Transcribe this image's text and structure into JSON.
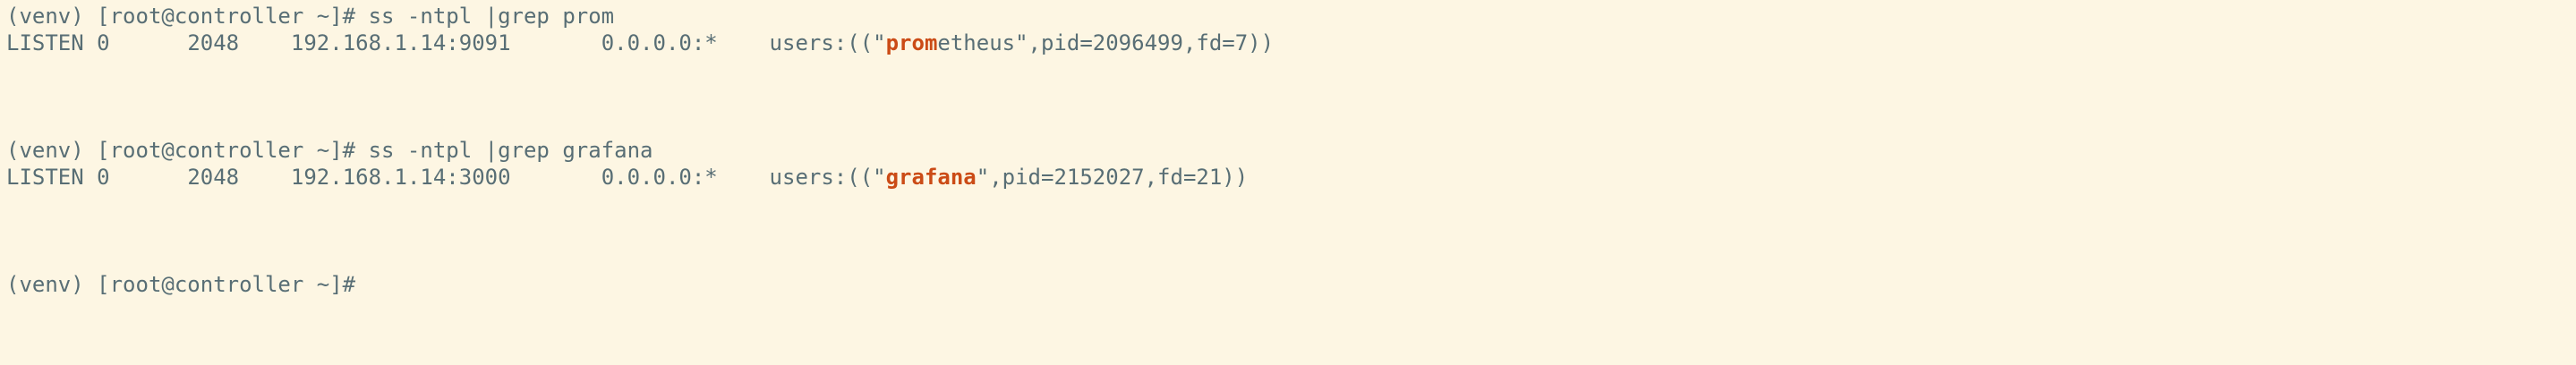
{
  "terminal": {
    "lines": [
      {
        "prompt": "(venv) [root@controller ~]# ",
        "command": "ss -ntpl |grep prom"
      },
      {
        "state": "LISTEN",
        "recvq": "0",
        "sendq": "2048",
        "local": "192.168.1.14:9091",
        "peer": "0.0.0.0:*",
        "users_prefix": "users:((\"",
        "match": "prom",
        "rest": "etheus\",pid=2096499,fd=7))"
      },
      {
        "prompt": "(venv) [root@controller ~]# ",
        "command": "ss -ntpl |grep grafana"
      },
      {
        "state": "LISTEN",
        "recvq": "0",
        "sendq": "2048",
        "local": "192.168.1.14:3000",
        "peer": "0.0.0.0:*",
        "users_prefix": "users:((\"",
        "match": "grafana",
        "rest": "\",pid=2152027,fd=21))"
      },
      {
        "prompt": "(venv) [root@controller ~]#",
        "command": ""
      }
    ],
    "colors": {
      "background": "#fdf6e3",
      "foreground": "#586e75",
      "match_highlight": "#cb4b16"
    }
  }
}
